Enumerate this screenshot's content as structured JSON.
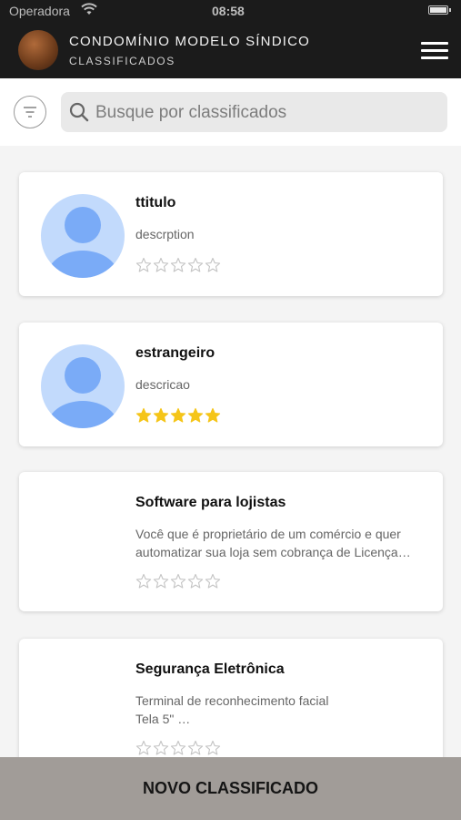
{
  "status_bar": {
    "carrier": "Operadora",
    "time": "08:58"
  },
  "header": {
    "title": "CONDOMÍNIO MODELO SÍNDICO",
    "subtitle": "CLASSIFICADOS"
  },
  "search": {
    "placeholder": "Busque por classificados"
  },
  "items": [
    {
      "title": "ttitulo",
      "description": "descrption",
      "rating": 0,
      "max_rating": 5,
      "has_avatar": true
    },
    {
      "title": "estrangeiro",
      "description": "descricao",
      "rating": 5,
      "max_rating": 5,
      "has_avatar": true
    },
    {
      "title": "Software para lojistas",
      "description": "Você que é proprietário de um comércio e quer\nautomatizar sua loja sem cobrança de Licença…",
      "rating": 0,
      "max_rating": 5,
      "has_avatar": false
    },
    {
      "title": "Segurança Eletrônica",
      "description": "Terminal de reconhecimento facial\nTela 5\" …",
      "rating": 0,
      "max_rating": 5,
      "has_avatar": false
    }
  ],
  "footer": {
    "button_label": "NOVO CLASSIFICADO"
  },
  "colors": {
    "star_filled": "#f5c518",
    "star_empty": "#c4c4c4",
    "avatar_bg": "#c2dafc",
    "avatar_fg": "#7aabf7"
  }
}
